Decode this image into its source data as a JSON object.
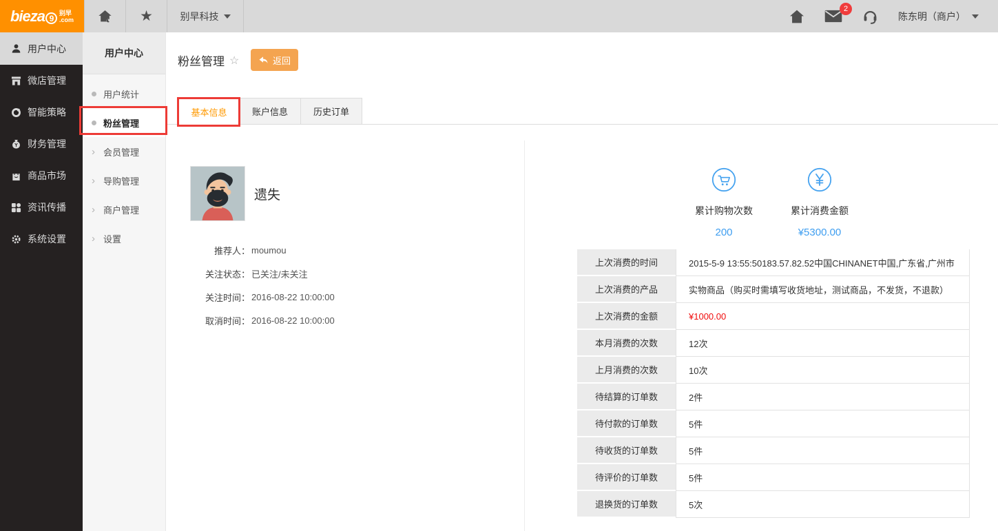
{
  "topbar": {
    "logo": {
      "main": "bieza",
      "nine": "9",
      "cn": "别早",
      "com": ".com"
    },
    "brand": "别早科技",
    "mail_badge": "2",
    "user": "陈东明（商户）"
  },
  "sidebar": {
    "items": [
      {
        "label": "用户中心",
        "active": true
      },
      {
        "label": "微店管理"
      },
      {
        "label": "智能策略"
      },
      {
        "label": "财务管理"
      },
      {
        "label": "商品市场"
      },
      {
        "label": "资讯传播"
      },
      {
        "label": "系统设置"
      }
    ]
  },
  "submenu": {
    "header": "用户中心",
    "items": [
      {
        "label": "用户统计"
      },
      {
        "label": "粉丝管理",
        "active": true,
        "annotated": true
      },
      {
        "label": "会员管理"
      },
      {
        "label": "导购管理"
      },
      {
        "label": "商户管理"
      },
      {
        "label": "设置"
      }
    ]
  },
  "page": {
    "title": "粉丝管理",
    "title_star": "☆",
    "back_button": "返回",
    "tabs": [
      {
        "label": "基本信息",
        "active": true,
        "annotated": true
      },
      {
        "label": "账户信息"
      },
      {
        "label": "历史订单"
      }
    ]
  },
  "profile": {
    "name": "遗失",
    "fields": [
      {
        "label": "推荐人：",
        "value": "moumou"
      },
      {
        "label": "关注状态：",
        "value": "已关注/未关注"
      },
      {
        "label": "关注时间：",
        "value": "2016-08-22 10:00:00"
      },
      {
        "label": "取消时间：",
        "value": "2016-08-22 10:00:00"
      }
    ]
  },
  "stats": [
    {
      "icon": "cart-icon",
      "label": "累计购物次数",
      "value": "200"
    },
    {
      "icon": "yen-icon",
      "label": "累计消费金额",
      "value": "¥5300.00"
    }
  ],
  "detail_table": {
    "rows": [
      {
        "label": "上次消费的时间",
        "value": "2015-5-9 13:55:50183.57.82.52中国CHINANET中国,广东省,广州市"
      },
      {
        "label": "上次消费的产品",
        "value": "实物商品（购买时需填写收货地址，测试商品，不发货，不退款）"
      },
      {
        "label": "上次消费的金额",
        "value": "¥1000.00",
        "value_class": "red"
      },
      {
        "label": "本月消费的次数",
        "value": "12次"
      },
      {
        "label": "上月消费的次数",
        "value": "10次"
      },
      {
        "label": "待结算的订单数",
        "value": "2件"
      },
      {
        "label": "待付款的订单数",
        "value": "5件"
      },
      {
        "label": "待收货的订单数",
        "value": "5件"
      },
      {
        "label": "待评价的订单数",
        "value": "5件"
      },
      {
        "label": "退换货的订单数",
        "value": "5次"
      }
    ]
  },
  "colors": {
    "logo_orange": "#ff9000",
    "button_orange": "#f4a450",
    "tab_active_orange": "#ff9900",
    "stat_blue": "#3f9ef0",
    "price_red": "#f00c0c",
    "annotation_red": "#ed3b36",
    "badge_red": "#f03b3b",
    "topbar_gray": "#d9d9d9",
    "sidebar_dark": "#252121"
  }
}
